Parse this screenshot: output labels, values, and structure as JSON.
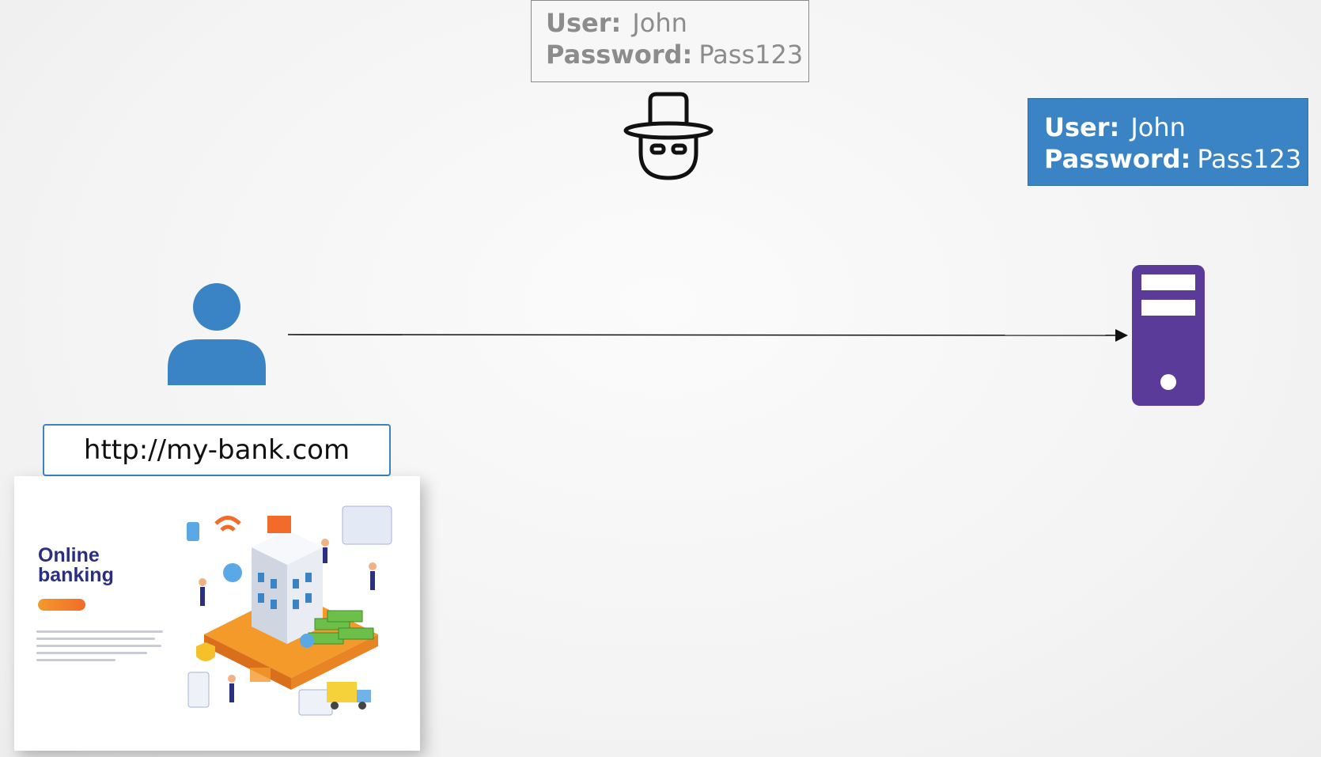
{
  "intercepted_credentials": {
    "user_label": "User:",
    "user_value": "John",
    "password_label": "Password:",
    "password_value": "Pass123"
  },
  "server_credentials": {
    "user_label": "User:",
    "user_value": "John",
    "password_label": "Password:",
    "password_value": "Pass123"
  },
  "browser": {
    "url": "http://my-bank.com",
    "page_title": "Online banking"
  },
  "icons": {
    "hacker": "hacker-icon",
    "user": "user-icon",
    "server": "server-icon",
    "arrow": "request-arrow"
  },
  "colors": {
    "blue": "#3a83c4",
    "purple": "#5b3b9a",
    "hacker_box_text": "#8c8c8c",
    "bank_title": "#2b2f7f"
  }
}
